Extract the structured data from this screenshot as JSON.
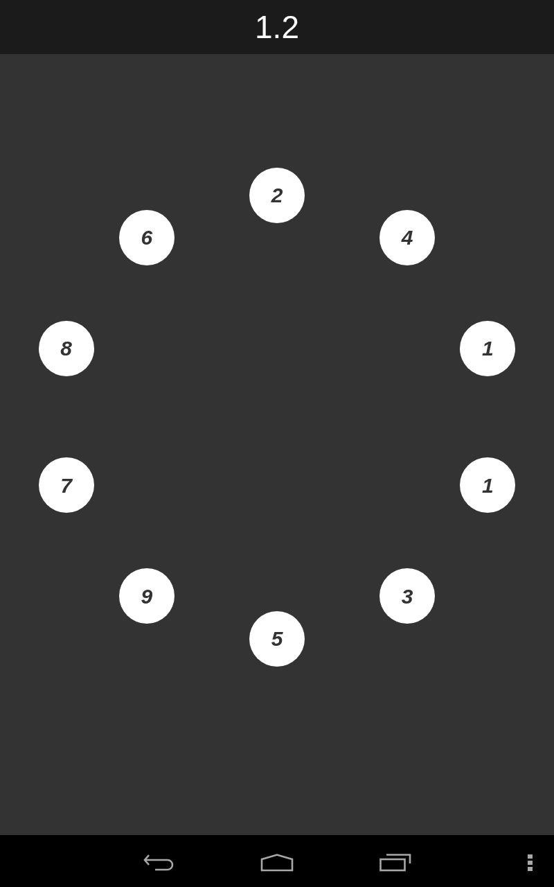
{
  "title": {
    "text": "1.2"
  },
  "numbers": [
    {
      "label": "2"
    },
    {
      "label": "4"
    },
    {
      "label": "1"
    },
    {
      "label": "1"
    },
    {
      "label": "3"
    },
    {
      "label": "5"
    },
    {
      "label": "9"
    },
    {
      "label": "7"
    },
    {
      "label": "8"
    },
    {
      "label": "6"
    }
  ],
  "nav_bar": {
    "buttons": [
      {
        "kind": "back"
      },
      {
        "kind": "home"
      },
      {
        "kind": "recents"
      },
      {
        "kind": "menu"
      }
    ]
  }
}
